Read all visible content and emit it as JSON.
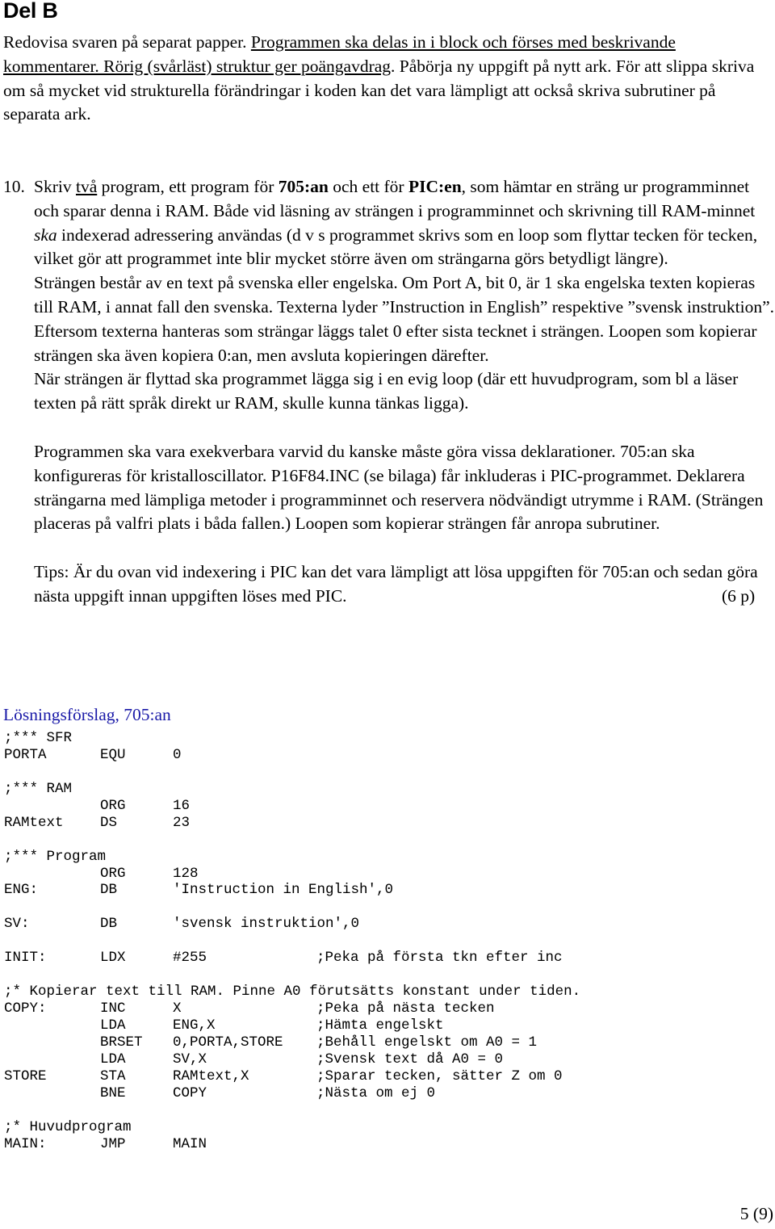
{
  "header": {
    "title": "Del B"
  },
  "intro": {
    "plain1": "Redovisa svaren på separat papper. ",
    "underlined": "Programmen ska delas in i block och förses med beskrivande kommentarer. Rörig (svårläst) struktur ger poängavdrag",
    "plain2": ". Påbörja ny uppgift på nytt ark. För att slippa skriva om så mycket vid strukturella förändringar i koden kan det vara lämpligt att också skriva subrutiner på separata ark."
  },
  "task": {
    "number": "10.",
    "p1": {
      "a": "Skriv ",
      "u": "två",
      "b": " program, ett program för ",
      "bold1": "705:an",
      "c": " och ett för ",
      "bold2": "PIC:en",
      "d": ", som hämtar en sträng ur programminnet och sparar denna i RAM. Både vid läsning av strängen i programminnet och skrivning till RAM-minnet ",
      "ital": "ska",
      "e": " indexerad adressering användas (d v s programmet skrivs som en loop som flyttar tecken för tecken, vilket gör att programmet inte blir mycket större även om strängarna görs betydligt längre)."
    },
    "p2": "Strängen består av en text på svenska eller engelska. Om Port A, bit 0, är 1 ska engelska texten kopieras till RAM, i annat fall den svenska. Texterna lyder ”Instruction in English” respektive ”svensk instruktion”. Eftersom texterna hanteras som strängar läggs talet 0 efter sista tecknet i strängen. Loopen som kopierar strängen ska även kopiera 0:an, men avsluta kopieringen därefter.",
    "p3": "När strängen är flyttad ska programmet lägga sig i en evig loop (där ett huvudprogram, som bl a läser texten på rätt språk direkt ur RAM, skulle kunna tänkas ligga).",
    "p4": "Programmen ska vara exekverbara varvid du kanske måste göra vissa deklarationer. 705:an ska konfigureras för kristalloscillator. P16F84.INC (se bilaga) får inkluderas i PIC-programmet. Deklarera strängarna med lämpliga metoder i programminnet och reservera nödvändigt utrymme i RAM. (Strängen placeras på valfri plats i båda fallen.) Loopen som kopierar strängen får anropa subrutiner.",
    "tips": "Tips: Är du ovan vid indexering i PIC kan det vara lämpligt att lösa uppgiften för 705:an och sedan göra nästa uppgift innan uppgiften löses med PIC.",
    "points": "(6 p)"
  },
  "solution": {
    "title": "Lösningsförslag, 705:an",
    "title_color": "#1a1aa8",
    "code": [
      {
        "full": ";*** SFR"
      },
      {
        "label": "PORTA",
        "op": "EQU",
        "arg": "0",
        "comment": ""
      },
      {
        "full": ""
      },
      {
        "full": ";*** RAM"
      },
      {
        "label": "",
        "op": "ORG",
        "arg": "16",
        "comment": ""
      },
      {
        "label": "RAMtext",
        "op": "DS",
        "arg": "23",
        "comment": ""
      },
      {
        "full": ""
      },
      {
        "full": ";*** Program"
      },
      {
        "label": "",
        "op": "ORG",
        "arg": "128",
        "comment": ""
      },
      {
        "label": "ENG:",
        "op": "DB",
        "arg": "'Instruction in English',0",
        "comment": ""
      },
      {
        "full": ""
      },
      {
        "label": "SV:",
        "op": "DB",
        "arg": "'svensk instruktion',0",
        "comment": ""
      },
      {
        "full": ""
      },
      {
        "label": "INIT:",
        "op": "LDX",
        "arg": "#255",
        "comment": ";Peka på första tkn efter inc"
      },
      {
        "full": ""
      },
      {
        "full": ";* Kopierar text till RAM. Pinne A0 förutsätts konstant under tiden."
      },
      {
        "label": "COPY:",
        "op": "INC",
        "arg": "X",
        "comment": ";Peka på nästa tecken"
      },
      {
        "label": "",
        "op": "LDA",
        "arg": "ENG,X",
        "comment": ";Hämta engelskt"
      },
      {
        "label": "",
        "op": "BRSET",
        "arg": "0,PORTA,STORE",
        "comment": ";Behåll engelskt om A0 = 1"
      },
      {
        "label": "",
        "op": "LDA",
        "arg": "SV,X",
        "comment": ";Svensk text då A0 = 0"
      },
      {
        "label": "STORE",
        "op": "STA",
        "arg": "RAMtext,X",
        "comment": ";Sparar tecken, sätter Z om 0"
      },
      {
        "label": "",
        "op": "BNE",
        "arg": "COPY",
        "comment": ";Nästa om ej 0"
      },
      {
        "full": ""
      },
      {
        "full": ";* Huvudprogram"
      },
      {
        "label": "MAIN:",
        "op": "JMP",
        "arg": "MAIN",
        "comment": ""
      }
    ]
  },
  "footer": {
    "page_number": "5 (9)"
  }
}
